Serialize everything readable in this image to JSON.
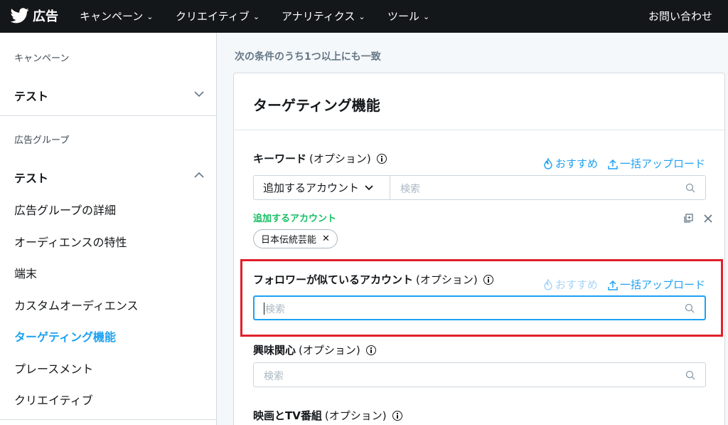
{
  "topbar": {
    "brand": "広告",
    "nav": [
      {
        "label": "キャンペーン"
      },
      {
        "label": "クリエイティブ"
      },
      {
        "label": "アナリティクス"
      },
      {
        "label": "ツール"
      }
    ],
    "help": "お問い合わせ"
  },
  "sidebar": {
    "campaign_section": "キャンペーン",
    "campaign_name": "テスト",
    "adgroup_section": "広告グループ",
    "adgroup_name": "テスト",
    "items": [
      {
        "label": "広告グループの詳細"
      },
      {
        "label": "オーディエンスの特性"
      },
      {
        "label": "端末"
      },
      {
        "label": "カスタムオーディエンス"
      },
      {
        "label": "ターゲティング機能"
      },
      {
        "label": "プレースメント"
      },
      {
        "label": "クリエイティブ"
      }
    ]
  },
  "main": {
    "heading": "次の条件のうち1つ以上にも一致",
    "card_title": "ターゲティング機能",
    "keyword": {
      "label": "キーワード",
      "optional": "(オプション)",
      "recommend": "おすすめ",
      "bulk_upload": "一括アップロード",
      "dropdown_value": "追加するアカウント",
      "search_placeholder": "検索",
      "added_label": "追加するアカウント",
      "tags": [
        "日本伝統芸能"
      ]
    },
    "follower": {
      "label": "フォロワーが似ているアカウント",
      "optional": "(オプション)",
      "recommend": "おすすめ",
      "bulk_upload": "一括アップロード",
      "search_placeholder": "検索"
    },
    "interest": {
      "label": "興味関心",
      "optional": "(オプション)",
      "search_placeholder": "検索"
    },
    "movie": {
      "label": "映画とTV番組",
      "optional": "(オプション)"
    }
  },
  "colors": {
    "topbar": "#14171a",
    "accent": "#1da1f2",
    "green": "#17bf63",
    "highlight": "#e0202b"
  }
}
